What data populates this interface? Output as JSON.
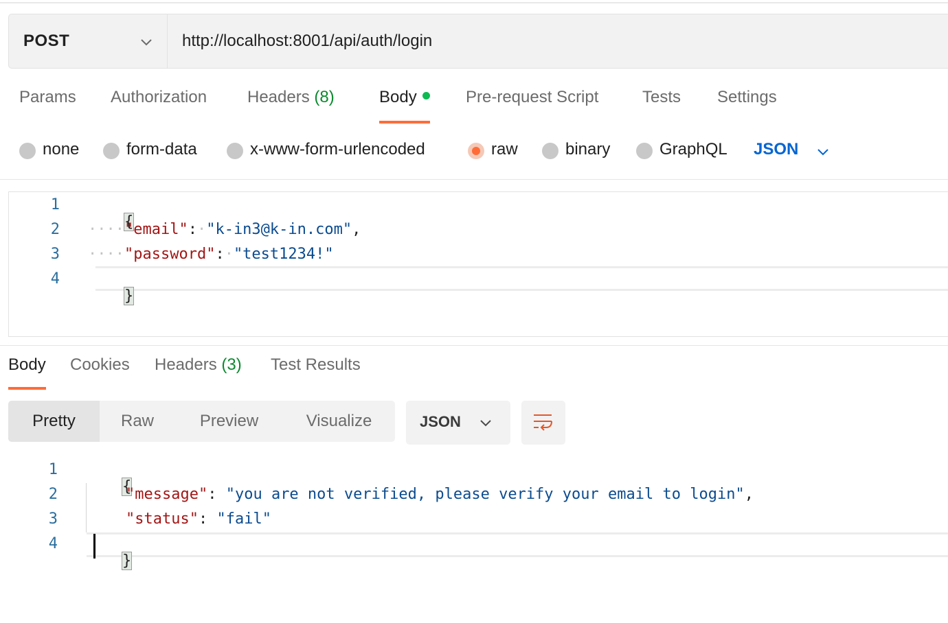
{
  "request": {
    "method": "POST",
    "url": "http://localhost:8001/api/auth/login"
  },
  "request_tabs": [
    {
      "label": "Params"
    },
    {
      "label": "Authorization"
    },
    {
      "label": "Headers",
      "count": "(8)"
    },
    {
      "label": "Body",
      "active": true,
      "has_dot": true
    },
    {
      "label": "Pre-request Script"
    },
    {
      "label": "Tests"
    },
    {
      "label": "Settings"
    }
  ],
  "body_types": [
    {
      "label": "none"
    },
    {
      "label": "form-data"
    },
    {
      "label": "x-www-form-urlencoded"
    },
    {
      "label": "raw",
      "selected": true
    },
    {
      "label": "binary"
    },
    {
      "label": "GraphQL"
    }
  ],
  "body_language": "JSON",
  "request_body": {
    "line_numbers": [
      "1",
      "2",
      "3",
      "4"
    ],
    "open_brace": "{",
    "close_brace": "}",
    "key_email": "\"email\"",
    "val_email": "\"k-in3@k-in.com\"",
    "key_password": "\"password\"",
    "val_password": "\"test1234!\"",
    "colon": ":",
    "comma": ",",
    "indent_dots": "····",
    "space_dot": "·"
  },
  "response_tabs": [
    {
      "label": "Body",
      "active": true
    },
    {
      "label": "Cookies"
    },
    {
      "label": "Headers",
      "count": "(3)"
    },
    {
      "label": "Test Results"
    }
  ],
  "view_modes": [
    {
      "label": "Pretty",
      "active": true
    },
    {
      "label": "Raw"
    },
    {
      "label": "Preview"
    },
    {
      "label": "Visualize"
    }
  ],
  "response_language": "JSON",
  "response_body": {
    "line_numbers": [
      "1",
      "2",
      "3",
      "4"
    ],
    "open_brace": "{",
    "close_brace": "}",
    "key_message": "\"message\"",
    "val_message": "\"you are not verified, please verify your email to login\"",
    "key_status": "\"status\"",
    "val_status": "\"fail\"",
    "colon": ":",
    "comma": ","
  },
  "icons": {
    "method_dropdown": "chevron-down-icon",
    "language_dropdown": "chevron-down-icon",
    "wrap": "wrap-lines-icon",
    "accent": "#ff6c37",
    "link": "#0265d2",
    "count_green": "#0a8a2e",
    "dot_green": "#0cbb52"
  }
}
